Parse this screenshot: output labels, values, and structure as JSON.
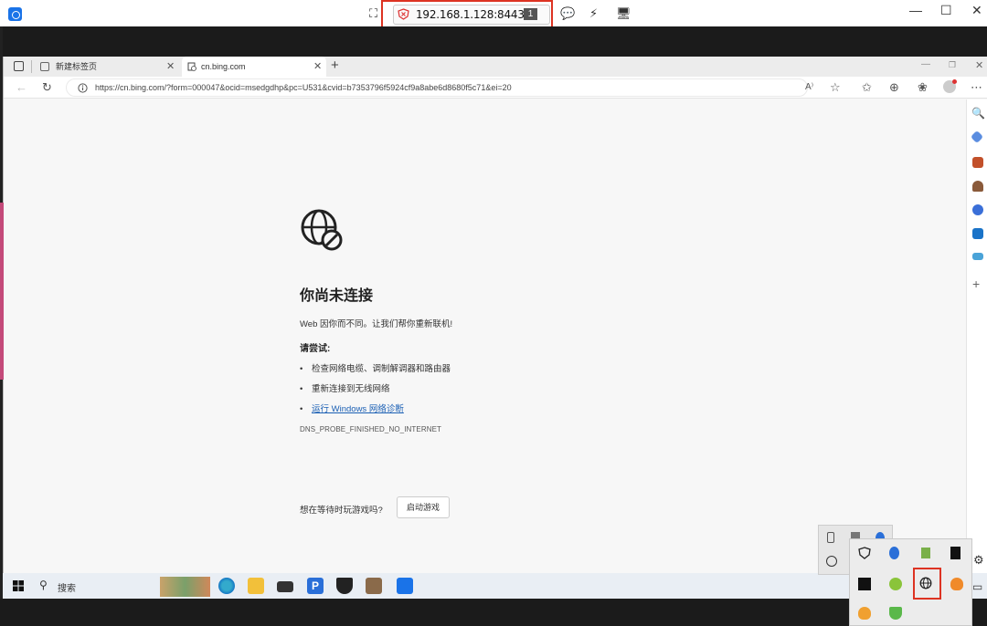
{
  "viewer": {
    "address": "192.168.1.128:8443",
    "badge": "1",
    "minimize": "—",
    "maximize": "☐",
    "close": "✕"
  },
  "browser": {
    "tabs": [
      {
        "label": "新建标签页"
      },
      {
        "label": "cn.bing.com"
      }
    ],
    "url": "https://cn.bing.com/?form=000047&ocid=msedgdhp&pc=U531&cvid=b7353796f5924cf9a8abe6d8680f5c71&ei=20"
  },
  "error_page": {
    "title": "你尚未连接",
    "description": "Web 因你而不同。让我们帮你重新联机!",
    "try_heading": "请尝试:",
    "items": [
      "检查网络电缆、调制解调器和路由器",
      "重新连接到无线网络",
      "运行 Windows 网络诊断"
    ],
    "error_code": "DNS_PROBE_FINISHED_NO_INTERNET",
    "game_question": "想在等待时玩游戏吗?",
    "game_button": "启动游戏"
  },
  "taskbar": {
    "search_label": "搜索"
  }
}
